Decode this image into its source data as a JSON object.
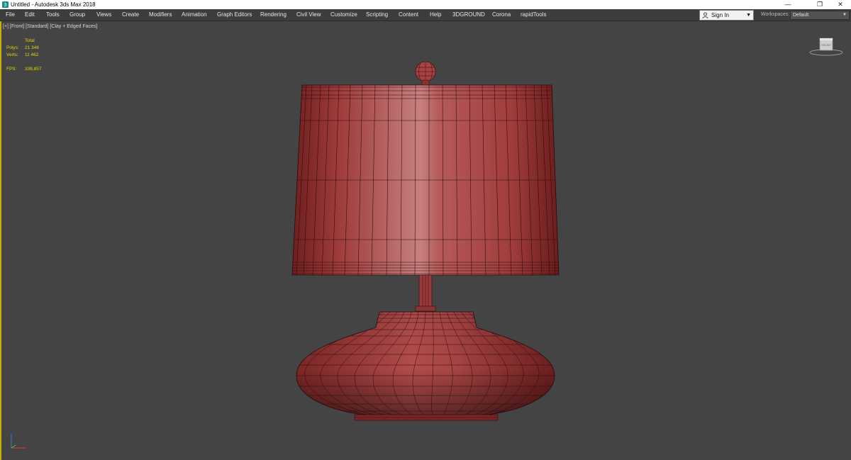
{
  "window": {
    "title": "Untitled - Autodesk 3ds Max 2018",
    "controls": {
      "minimize": "—",
      "restore": "❐",
      "close": "✕"
    }
  },
  "menu": {
    "items": [
      "File",
      "Edit",
      "Tools",
      "Group",
      "Views",
      "Create",
      "Modifiers",
      "Animation",
      "Graph Editors",
      "Rendering",
      "Civil View",
      "Customize",
      "Scripting",
      "Content",
      "Help",
      "3DGROUND",
      "Corona",
      "rapidTools"
    ]
  },
  "account": {
    "signin_label": "Sign In",
    "dropdown_icon": "chevron-down-icon"
  },
  "workspace": {
    "label": "Workspaces:",
    "value": "Default"
  },
  "viewport": {
    "label": "[+] [Front] [Standard] [Clay + Edged Faces]",
    "stats": {
      "header": "Total",
      "polys_label": "Polys:",
      "polys_value": "21 346",
      "verts_label": "Verts:",
      "verts_value": "11 462",
      "fps_label": "FPS:",
      "fps_value": "338,857"
    },
    "viewcube_icon": "viewcube-icon",
    "axis_icon": "axis-tripod-icon",
    "object": "table-lamp-mesh"
  },
  "colors": {
    "viewport_bg": "#444444",
    "active_border": "#c8b000",
    "stats_text": "#e3d400",
    "clay": "#b04848",
    "wire": "#2a0a0a"
  }
}
